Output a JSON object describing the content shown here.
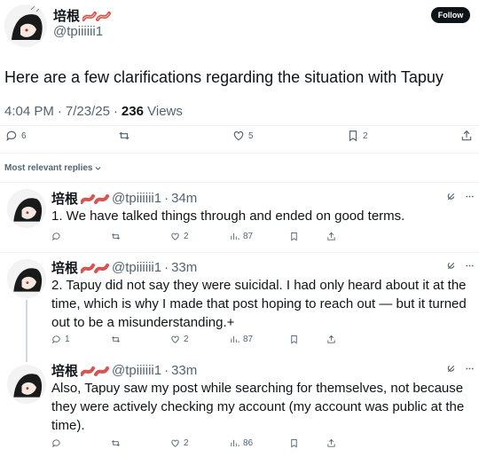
{
  "main_post": {
    "display_name": "培根",
    "handle": "@tpiiiiii1",
    "follow_label": "Follow",
    "text": "Here are a few clarifications regarding the situation with Tapuy",
    "time": "4:04 PM",
    "date": "7/23/25",
    "views_count": "236",
    "views_label": "Views",
    "separator": "·",
    "replies": "6",
    "likes": "5",
    "bookmarks": "2"
  },
  "replies_filter": {
    "label": "Most relevant replies"
  },
  "replies": [
    {
      "display_name": "培根",
      "handle": "@tpiiiiii1",
      "separator": "·",
      "age": "34m",
      "text": "1. We have talked things through and ended on good terms.",
      "replies": "",
      "likes": "2",
      "views": "87"
    },
    {
      "display_name": "培根",
      "handle": "@tpiiiiii1",
      "separator": "·",
      "age": "33m",
      "text": "2. Tapuy did not say they were suicidal. I had only heard about it at the time, which is why I made that post hoping to reach out — but it turned out to be a misunderstanding.+",
      "replies": "1",
      "likes": "2",
      "views": "87"
    },
    {
      "display_name": "培根",
      "handle": "@tpiiiiii1",
      "separator": "·",
      "age": "33m",
      "text": "Also, Tapuy saw my post while searching for themselves, not because they were actively checking my account (my account was public at the time).",
      "replies": "",
      "likes": "2",
      "views": "86"
    }
  ],
  "colors": {
    "text": "#0f1419",
    "secondary": "#536471",
    "divider": "#eff3f4",
    "bacon": "#d9534f"
  },
  "icons": [
    "reply-icon",
    "retweet-icon",
    "like-icon",
    "bookmark-icon",
    "share-icon",
    "views-icon",
    "grok-icon",
    "more-icon",
    "bacon-emoji-icon",
    "chevron-down-icon"
  ]
}
